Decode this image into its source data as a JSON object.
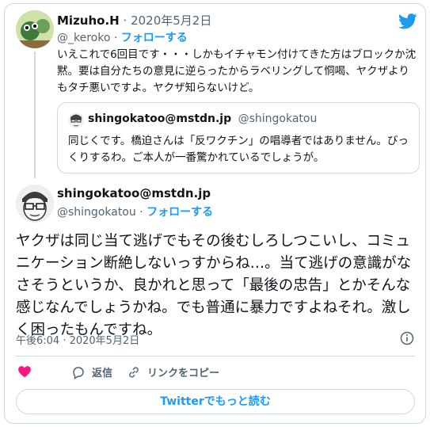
{
  "parent_tweet": {
    "name": "Mizuho.H",
    "separator": "·",
    "date": "2020年5月2日",
    "handle": "@_keroko",
    "follow_label": "フォローする",
    "text": "いえこれで6回目です・・・しかもイチャモン付けてきた方はブロックか沈黙。要は自分たちの意見に逆らったからラベリングして恫喝、ヤクザよりもタチ悪いですよ。ヤクザ知らないけど。"
  },
  "quoted_tweet": {
    "name": "shingokatoo@mstdn.jp",
    "handle": "@shingokatou",
    "text": "同じくです。橋迫さんは「反ワクチン」の唱導者ではありません。びっくりするわ。ご本人が一番驚かれているでしょうが。"
  },
  "main_tweet": {
    "name": "shingokatoo@mstdn.jp",
    "handle": "@shingokatou",
    "separator": "·",
    "follow_label": "フォローする",
    "text": "ヤクザは同じ当て逃げでもその後むしろしつこいし、コミュニケーション断絶しないっすからね…。当て逃げの意識がなさそうというか、良かれと思って「最後の忠告」とかそんな感じなんでしょうかね。でも普通に暴力ですよねそれ。激しく困ったもんですね。",
    "timestamp": "午後6:04 · 2020年5月2日"
  },
  "actions": {
    "like_icon": "heart-icon",
    "reply_label": "返信",
    "reply_icon": "reply-icon",
    "copy_link_label": "リンクをコピー",
    "copy_link_icon": "link-icon"
  },
  "read_more_label": "Twitterでもっと読む",
  "colors": {
    "accent": "#1d9bf0",
    "like": "#f91880",
    "secondary_text": "#536471",
    "border": "#cfd9de"
  }
}
